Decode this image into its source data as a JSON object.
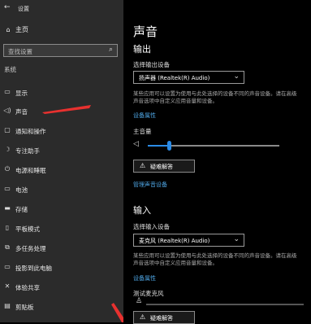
{
  "window": {
    "title": "设置",
    "back_icon": "back-arrow-icon"
  },
  "sidebar": {
    "home_label": "主页",
    "search_placeholder": "查找设置",
    "section_label": "系统",
    "items": [
      {
        "label": "显示",
        "icon": "display-icon"
      },
      {
        "label": "声音",
        "icon": "speaker-icon"
      },
      {
        "label": "通知和操作",
        "icon": "notification-icon"
      },
      {
        "label": "专注助手",
        "icon": "moon-icon"
      },
      {
        "label": "电源和睡眠",
        "icon": "power-icon"
      },
      {
        "label": "电池",
        "icon": "battery-icon"
      },
      {
        "label": "存储",
        "icon": "storage-icon"
      },
      {
        "label": "平板模式",
        "icon": "tablet-icon"
      },
      {
        "label": "多任务处理",
        "icon": "multitask-icon"
      },
      {
        "label": "投影到此电脑",
        "icon": "project-icon"
      },
      {
        "label": "体验共享",
        "icon": "share-icon"
      },
      {
        "label": "剪贴板",
        "icon": "clipboard-icon"
      }
    ],
    "arrow_color": "#e8312f"
  },
  "main": {
    "title": "声音",
    "output": {
      "heading": "输出",
      "device_label": "选择输出设备",
      "device_value": "扬声器 (Realtek(R) Audio)",
      "description": "某些应用可以设置为使用与此处选择的设备不同的声音设备。请在高级声音选项中自定义应用音量和设备。",
      "properties_link": "设备属性",
      "master_volume_label": "主音量",
      "master_volume_value": "16",
      "master_volume_level": 0.16,
      "troubleshoot_label": "疑难解答",
      "manage_link": "管理声音设备"
    },
    "input": {
      "heading": "输入",
      "device_label": "选择输入设备",
      "device_value": "麦克风 (Realtek(R) Audio)",
      "description": "某些应用可以设置为使用与此处选择的设备不同的声音设备。请在高级声音选项中自定义应用音量和设备。",
      "properties_link": "设备属性",
      "test_label": "测试麦克风",
      "troubleshoot_label": "疑难解答"
    },
    "accent_color": "#2b8be6",
    "link_color": "#4fa7e6"
  }
}
